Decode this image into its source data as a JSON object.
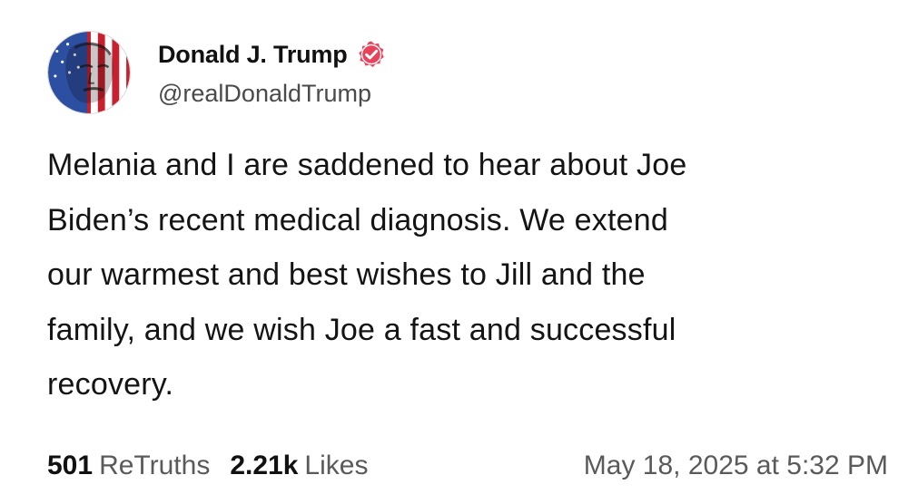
{
  "author": {
    "display_name": "Donald J. Trump",
    "handle": "@realDonaldTrump",
    "verified": true,
    "avatar_icon": "flag-portrait-avatar",
    "badge_icon": "verified-check-icon",
    "badge_color": "#e8435a"
  },
  "post": {
    "lines": [
      "Melania and I are saddened to hear about Joe",
      "Biden’s recent medical diagnosis. We extend",
      "our warmest and best wishes to Jill and the",
      "family, and we wish Joe a fast and successful",
      "recovery."
    ]
  },
  "stats": {
    "retruths_count": "501",
    "retruths_label": "ReTruths",
    "likes_count": "2.21k",
    "likes_label": "Likes"
  },
  "timestamp": "May 18, 2025 at 5:32 PM"
}
